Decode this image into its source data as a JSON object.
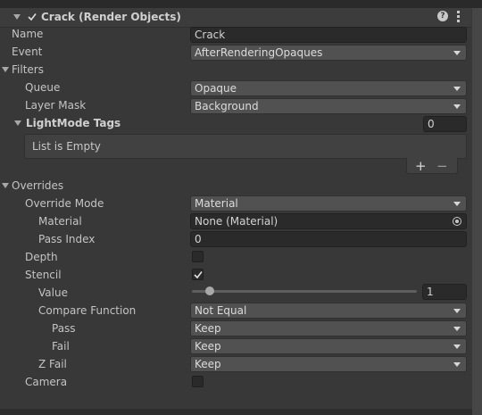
{
  "component": {
    "title": "Crack (Render Objects)",
    "enabled": true
  },
  "fields": {
    "name_label": "Name",
    "name_value": "Crack",
    "event_label": "Event",
    "event_value": "AfterRenderingOpaques",
    "filters_label": "Filters",
    "queue_label": "Queue",
    "queue_value": "Opaque",
    "layer_mask_label": "Layer Mask",
    "layer_mask_value": "Background",
    "lightmode_label": "LightMode Tags",
    "lightmode_count": "0",
    "list_empty_text": "List is Empty",
    "overrides_label": "Overrides",
    "override_mode_label": "Override Mode",
    "override_mode_value": "Material",
    "material_label": "Material",
    "material_value": "None (Material)",
    "pass_index_label": "Pass Index",
    "pass_index_value": "0",
    "depth_label": "Depth",
    "depth_checked": false,
    "stencil_label": "Stencil",
    "stencil_checked": true,
    "value_label": "Value",
    "value_value": "1",
    "value_slider_fraction": 0.08,
    "compare_function_label": "Compare Function",
    "compare_function_value": "Not Equal",
    "pass_label": "Pass",
    "pass_value": "Keep",
    "fail_label": "Fail",
    "fail_value": "Keep",
    "zfail_label": "Z Fail",
    "zfail_value": "Keep",
    "camera_label": "Camera",
    "camera_checked": false
  },
  "list_buttons": {
    "add": "+",
    "remove": "−"
  },
  "icons": [
    "foldout-down-icon",
    "checkmark-icon",
    "help-icon",
    "kebab-menu-icon",
    "object-picker-icon",
    "dropdown-arrow-icon",
    "plus-icon",
    "minus-icon"
  ],
  "colors": {
    "background": "#383838",
    "field": "#2a2a2a",
    "dropdown": "#515151",
    "text": "#c4c4c4"
  }
}
